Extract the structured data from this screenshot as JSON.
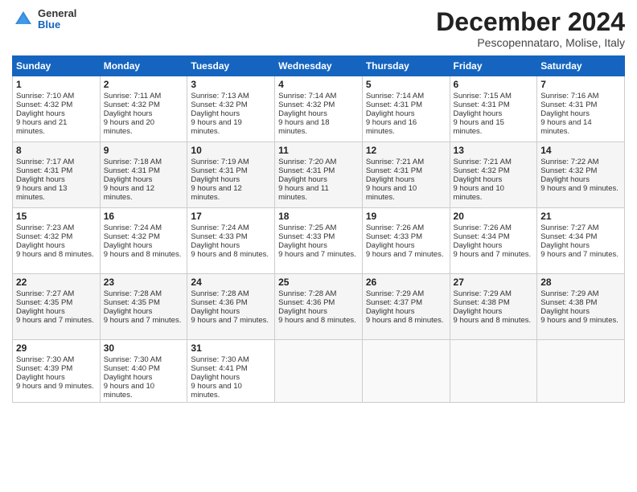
{
  "header": {
    "logo_general": "General",
    "logo_blue": "Blue",
    "title": "December 2024",
    "subtitle": "Pescopennataro, Molise, Italy"
  },
  "columns": [
    "Sunday",
    "Monday",
    "Tuesday",
    "Wednesday",
    "Thursday",
    "Friday",
    "Saturday"
  ],
  "weeks": [
    [
      {
        "day": 1,
        "sunrise": "7:10 AM",
        "sunset": "4:32 PM",
        "daylight": "9 hours and 21 minutes."
      },
      {
        "day": 2,
        "sunrise": "7:11 AM",
        "sunset": "4:32 PM",
        "daylight": "9 hours and 20 minutes."
      },
      {
        "day": 3,
        "sunrise": "7:13 AM",
        "sunset": "4:32 PM",
        "daylight": "9 hours and 19 minutes."
      },
      {
        "day": 4,
        "sunrise": "7:14 AM",
        "sunset": "4:32 PM",
        "daylight": "9 hours and 18 minutes."
      },
      {
        "day": 5,
        "sunrise": "7:14 AM",
        "sunset": "4:31 PM",
        "daylight": "9 hours and 16 minutes."
      },
      {
        "day": 6,
        "sunrise": "7:15 AM",
        "sunset": "4:31 PM",
        "daylight": "9 hours and 15 minutes."
      },
      {
        "day": 7,
        "sunrise": "7:16 AM",
        "sunset": "4:31 PM",
        "daylight": "9 hours and 14 minutes."
      }
    ],
    [
      {
        "day": 8,
        "sunrise": "7:17 AM",
        "sunset": "4:31 PM",
        "daylight": "9 hours and 13 minutes."
      },
      {
        "day": 9,
        "sunrise": "7:18 AM",
        "sunset": "4:31 PM",
        "daylight": "9 hours and 12 minutes."
      },
      {
        "day": 10,
        "sunrise": "7:19 AM",
        "sunset": "4:31 PM",
        "daylight": "9 hours and 12 minutes."
      },
      {
        "day": 11,
        "sunrise": "7:20 AM",
        "sunset": "4:31 PM",
        "daylight": "9 hours and 11 minutes."
      },
      {
        "day": 12,
        "sunrise": "7:21 AM",
        "sunset": "4:31 PM",
        "daylight": "9 hours and 10 minutes."
      },
      {
        "day": 13,
        "sunrise": "7:21 AM",
        "sunset": "4:32 PM",
        "daylight": "9 hours and 10 minutes."
      },
      {
        "day": 14,
        "sunrise": "7:22 AM",
        "sunset": "4:32 PM",
        "daylight": "9 hours and 9 minutes."
      }
    ],
    [
      {
        "day": 15,
        "sunrise": "7:23 AM",
        "sunset": "4:32 PM",
        "daylight": "9 hours and 8 minutes."
      },
      {
        "day": 16,
        "sunrise": "7:24 AM",
        "sunset": "4:32 PM",
        "daylight": "9 hours and 8 minutes."
      },
      {
        "day": 17,
        "sunrise": "7:24 AM",
        "sunset": "4:33 PM",
        "daylight": "9 hours and 8 minutes."
      },
      {
        "day": 18,
        "sunrise": "7:25 AM",
        "sunset": "4:33 PM",
        "daylight": "9 hours and 7 minutes."
      },
      {
        "day": 19,
        "sunrise": "7:26 AM",
        "sunset": "4:33 PM",
        "daylight": "9 hours and 7 minutes."
      },
      {
        "day": 20,
        "sunrise": "7:26 AM",
        "sunset": "4:34 PM",
        "daylight": "9 hours and 7 minutes."
      },
      {
        "day": 21,
        "sunrise": "7:27 AM",
        "sunset": "4:34 PM",
        "daylight": "9 hours and 7 minutes."
      }
    ],
    [
      {
        "day": 22,
        "sunrise": "7:27 AM",
        "sunset": "4:35 PM",
        "daylight": "9 hours and 7 minutes."
      },
      {
        "day": 23,
        "sunrise": "7:28 AM",
        "sunset": "4:35 PM",
        "daylight": "9 hours and 7 minutes."
      },
      {
        "day": 24,
        "sunrise": "7:28 AM",
        "sunset": "4:36 PM",
        "daylight": "9 hours and 7 minutes."
      },
      {
        "day": 25,
        "sunrise": "7:28 AM",
        "sunset": "4:36 PM",
        "daylight": "9 hours and 8 minutes."
      },
      {
        "day": 26,
        "sunrise": "7:29 AM",
        "sunset": "4:37 PM",
        "daylight": "9 hours and 8 minutes."
      },
      {
        "day": 27,
        "sunrise": "7:29 AM",
        "sunset": "4:38 PM",
        "daylight": "9 hours and 8 minutes."
      },
      {
        "day": 28,
        "sunrise": "7:29 AM",
        "sunset": "4:38 PM",
        "daylight": "9 hours and 9 minutes."
      }
    ],
    [
      {
        "day": 29,
        "sunrise": "7:30 AM",
        "sunset": "4:39 PM",
        "daylight": "9 hours and 9 minutes."
      },
      {
        "day": 30,
        "sunrise": "7:30 AM",
        "sunset": "4:40 PM",
        "daylight": "9 hours and 10 minutes."
      },
      {
        "day": 31,
        "sunrise": "7:30 AM",
        "sunset": "4:41 PM",
        "daylight": "9 hours and 10 minutes."
      },
      null,
      null,
      null,
      null
    ]
  ]
}
